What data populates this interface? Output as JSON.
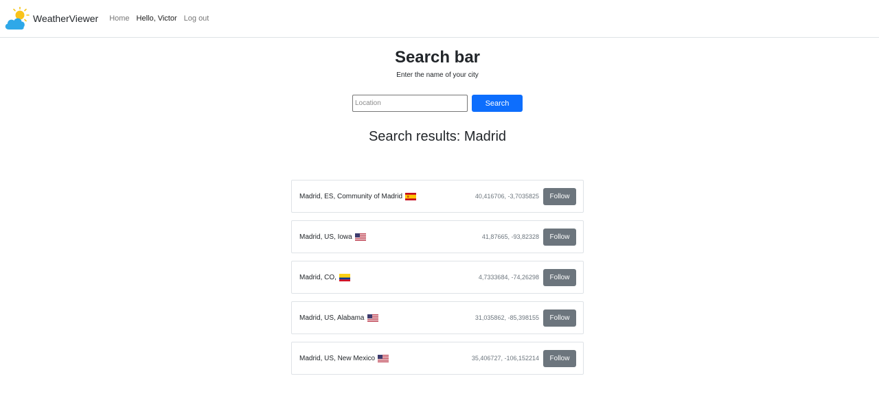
{
  "brand": {
    "name": "WeatherViewer"
  },
  "nav": {
    "home": "Home",
    "greeting": "Hello, Victor",
    "logout": "Log out"
  },
  "search": {
    "title": "Search bar",
    "subtitle": "Enter the name of your city",
    "placeholder": "Location",
    "value": "",
    "button_label": "Search"
  },
  "results": {
    "title": "Search results: Madrid",
    "follow_label": "Follow",
    "items": [
      {
        "name": "Madrid, ES, Community of Madrid",
        "country": "ES",
        "coords": "40,416706, -3,7035825",
        "flag_icon": "spain-flag-icon"
      },
      {
        "name": "Madrid, US, Iowa",
        "country": "US",
        "coords": "41,87665, -93,82328",
        "flag_icon": "us-flag-icon"
      },
      {
        "name": "Madrid, CO,",
        "country": "CO",
        "coords": "4,7333684, -74,26298",
        "flag_icon": "colombia-flag-icon"
      },
      {
        "name": "Madrid, US, Alabama",
        "country": "US",
        "coords": "31,035862, -85,398155",
        "flag_icon": "us-flag-icon"
      },
      {
        "name": "Madrid, US, New Mexico",
        "country": "US",
        "coords": "35,406727, -106,152214",
        "flag_icon": "us-flag-icon"
      }
    ]
  },
  "colors": {
    "primary": "#0d6efd",
    "secondary": "#6c757d",
    "border": "#dee2e6"
  }
}
